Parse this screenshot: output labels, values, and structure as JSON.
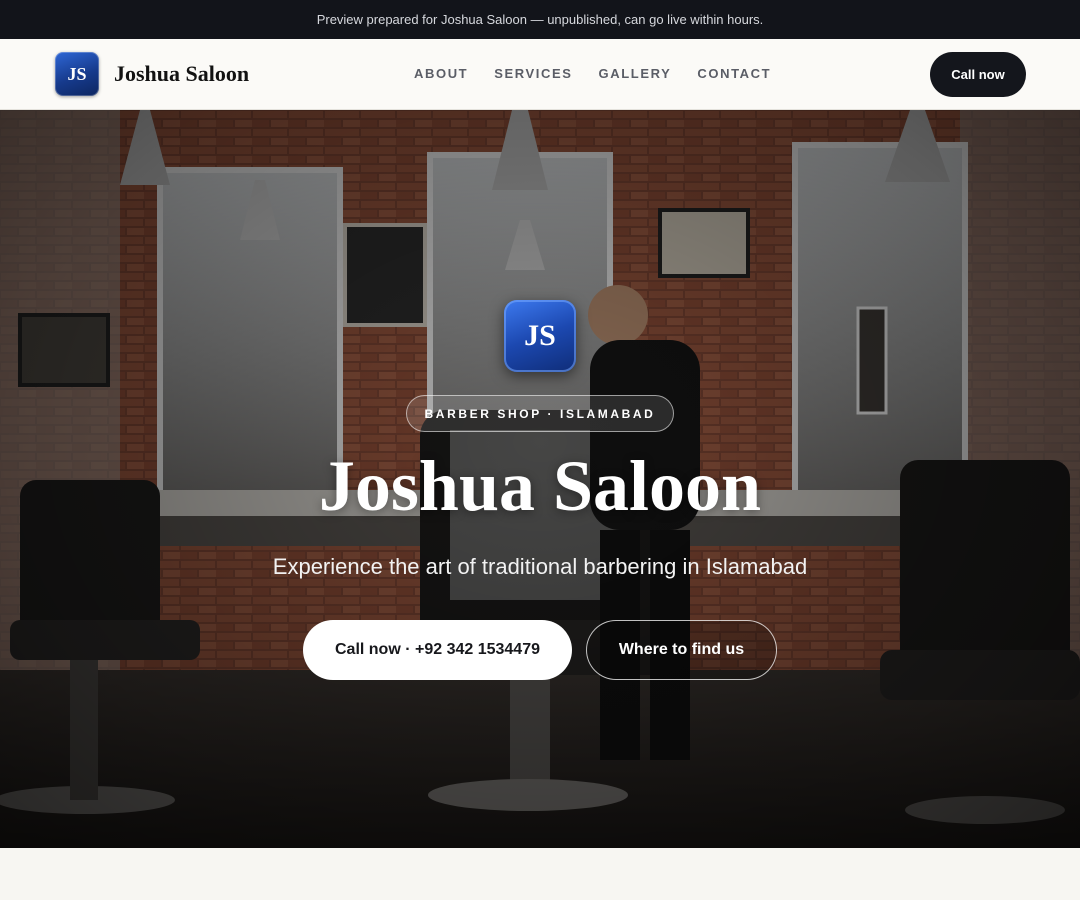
{
  "banner": {
    "text": "Preview prepared for Joshua Saloon — unpublished, can go live within hours."
  },
  "header": {
    "logo_initials": "JS",
    "brand_name": "Joshua Saloon",
    "nav": [
      {
        "label": "ABOUT"
      },
      {
        "label": "SERVICES"
      },
      {
        "label": "GALLERY"
      },
      {
        "label": "CONTACT"
      }
    ],
    "cta_label": "Call now"
  },
  "hero": {
    "logo_initials": "JS",
    "tag": "BARBER SHOP · ISLAMABAD",
    "title": "Joshua Saloon",
    "subtitle": "Experience the art of traditional barbering in Islamabad",
    "primary_button": "Call now · +92 342 1534479",
    "secondary_button": "Where to find us",
    "background": "barber-shop-interior-photo"
  },
  "colors": {
    "banner_bg": "#12141a",
    "brand_blue": "#1c48b0",
    "cta_dark": "#14161c",
    "page_bg": "#f7f6f2"
  }
}
